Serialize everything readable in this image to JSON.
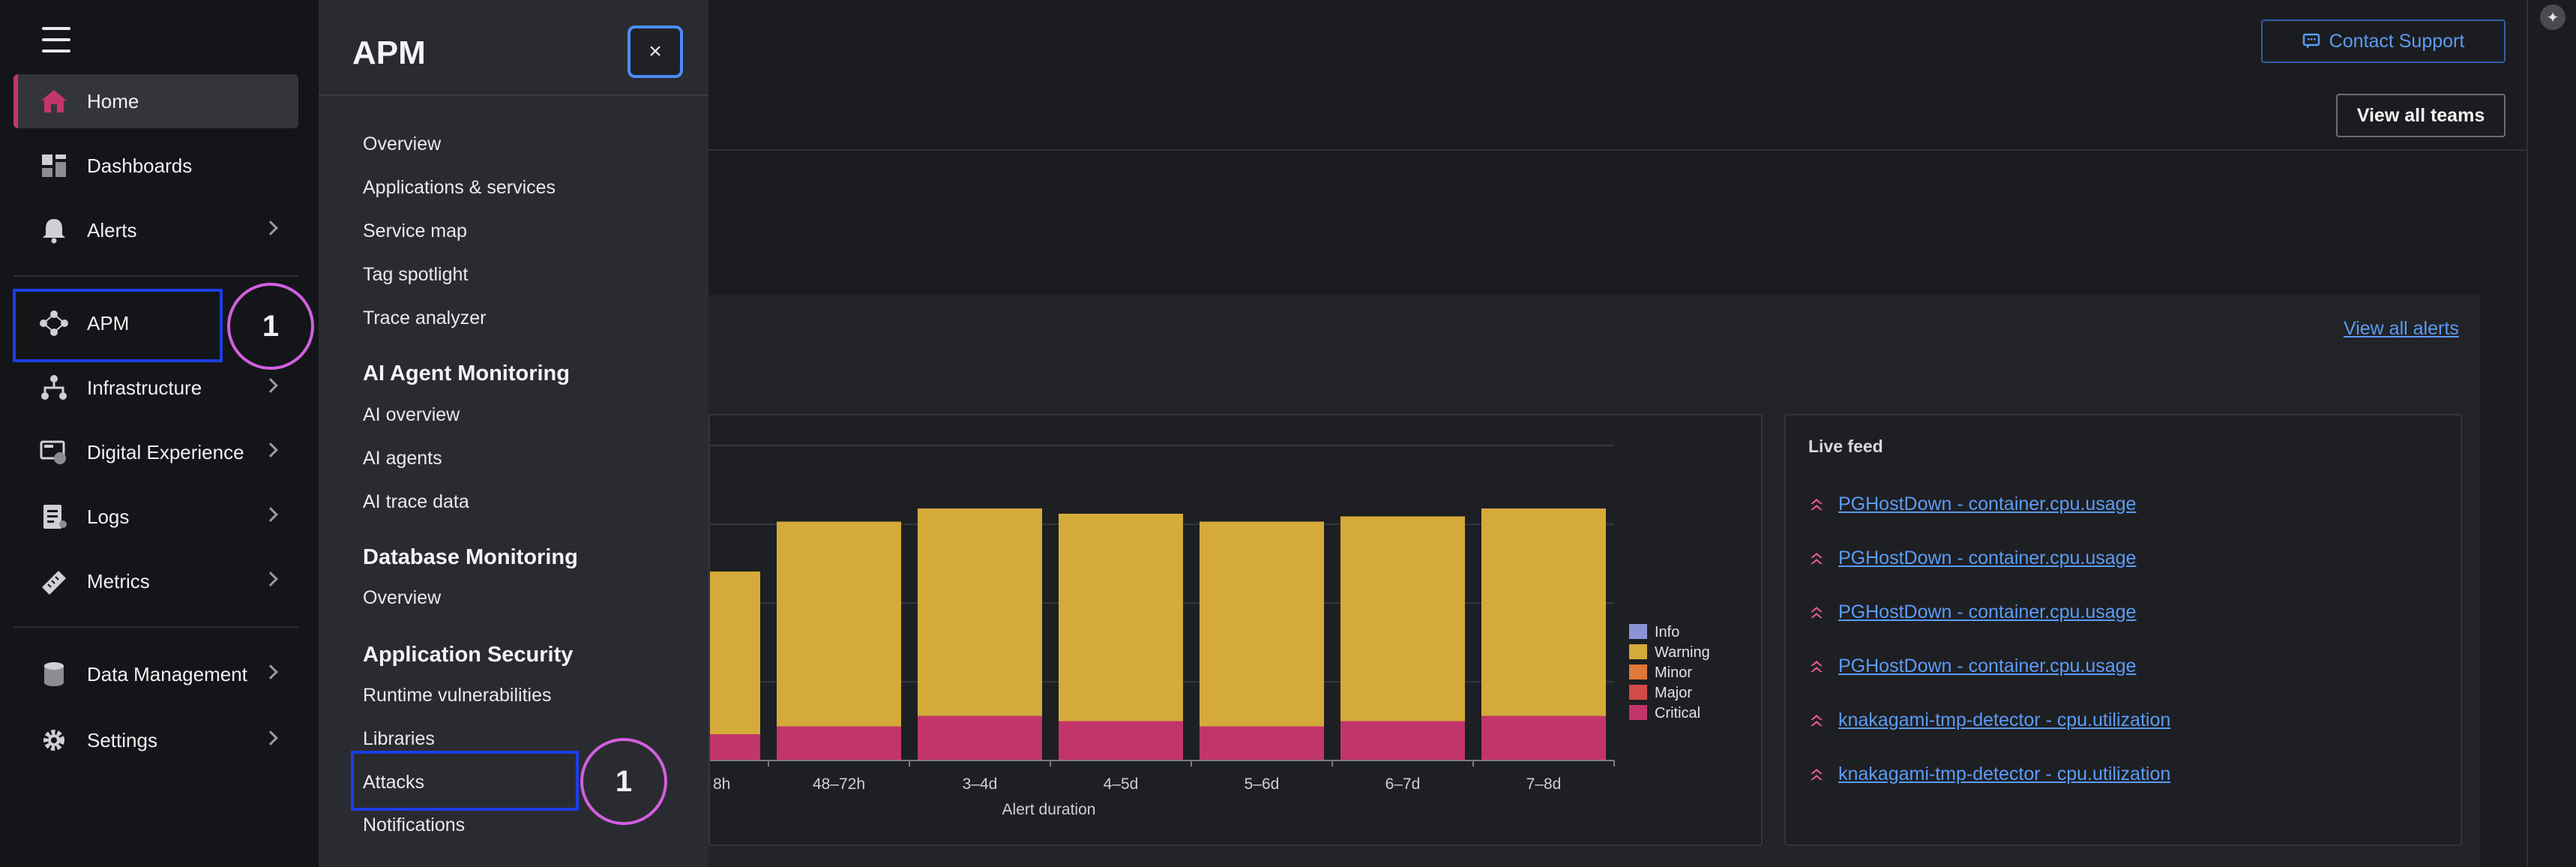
{
  "left_nav": {
    "items": [
      {
        "label": "Home",
        "icon": "home-icon",
        "active": true,
        "chevron": false
      },
      {
        "label": "Dashboards",
        "icon": "dashboards-icon",
        "chevron": false
      },
      {
        "label": "Alerts",
        "icon": "bell-icon",
        "chevron": true
      },
      {
        "label": "APM",
        "icon": "apm-icon",
        "chevron": false
      },
      {
        "label": "Infrastructure",
        "icon": "infrastructure-icon",
        "chevron": true
      },
      {
        "label": "Digital Experience",
        "icon": "digital-experience-icon",
        "chevron": true
      },
      {
        "label": "Logs",
        "icon": "logs-icon",
        "chevron": true
      },
      {
        "label": "Metrics",
        "icon": "metrics-icon",
        "chevron": true
      },
      {
        "label": "Data Management",
        "icon": "database-icon",
        "chevron": true
      },
      {
        "label": "Settings",
        "icon": "gear-icon",
        "chevron": true
      }
    ],
    "apm_marker": "1"
  },
  "apm_panel": {
    "title": "APM",
    "close_symbol": "×",
    "links_main": [
      "Overview",
      "Applications & services",
      "Service map",
      "Tag spotlight",
      "Trace analyzer"
    ],
    "ai_heading": "AI Agent Monitoring",
    "links_ai": [
      "AI overview",
      "AI agents",
      "AI trace data"
    ],
    "db_heading": "Database Monitoring",
    "links_db": [
      "Overview"
    ],
    "security_heading": "Application Security",
    "links_security": [
      "Runtime vulnerabilities",
      "Libraries",
      "Attacks",
      "Notifications"
    ],
    "attacks_marker": "1"
  },
  "header": {
    "contact_support": "Contact Support",
    "view_all_teams": "View all teams"
  },
  "alerts": {
    "view_all_alerts": "View all alerts"
  },
  "chart_data": {
    "type": "bar",
    "stacked": true,
    "xlabel": "Alert duration",
    "categories": [
      "8h",
      "48–72h",
      "3–4d",
      "4–5d",
      "5–6d",
      "6–7d",
      "7–8d"
    ],
    "first_category_partial": true,
    "series": [
      {
        "name": "Info",
        "color": "#8b93d6",
        "values": [
          0,
          0,
          0,
          0,
          0,
          0,
          0
        ]
      },
      {
        "name": "Warning",
        "color": "#d4ab3a",
        "values": [
          62,
          78,
          79,
          79,
          78,
          78,
          79
        ]
      },
      {
        "name": "Minor",
        "color": "#e0783a",
        "values": [
          0,
          0,
          0,
          0,
          0,
          0,
          0
        ]
      },
      {
        "name": "Major",
        "color": "#d24b4b",
        "values": [
          0,
          0,
          0,
          0,
          0,
          0,
          0
        ]
      },
      {
        "name": "Critical",
        "color": "#c2356b",
        "values": [
          10,
          13,
          17,
          15,
          13,
          15,
          17
        ]
      }
    ],
    "ylim": [
      0,
      120
    ],
    "grid": true,
    "legend": "right"
  },
  "live_feed": {
    "title": "Live feed",
    "items": [
      "PGHostDown - container.cpu.usage",
      "PGHostDown - container.cpu.usage",
      "PGHostDown - container.cpu.usage",
      "PGHostDown - container.cpu.usage",
      "knakagami-tmp-detector - cpu.utilization",
      "knakagami-tmp-detector - cpu.utilization"
    ]
  },
  "colors": {
    "accent_pink": "#c2356b",
    "link_blue": "#5b9cf5",
    "highlight_box": "#1c3ee6",
    "marker_circle": "#d15fe0"
  }
}
